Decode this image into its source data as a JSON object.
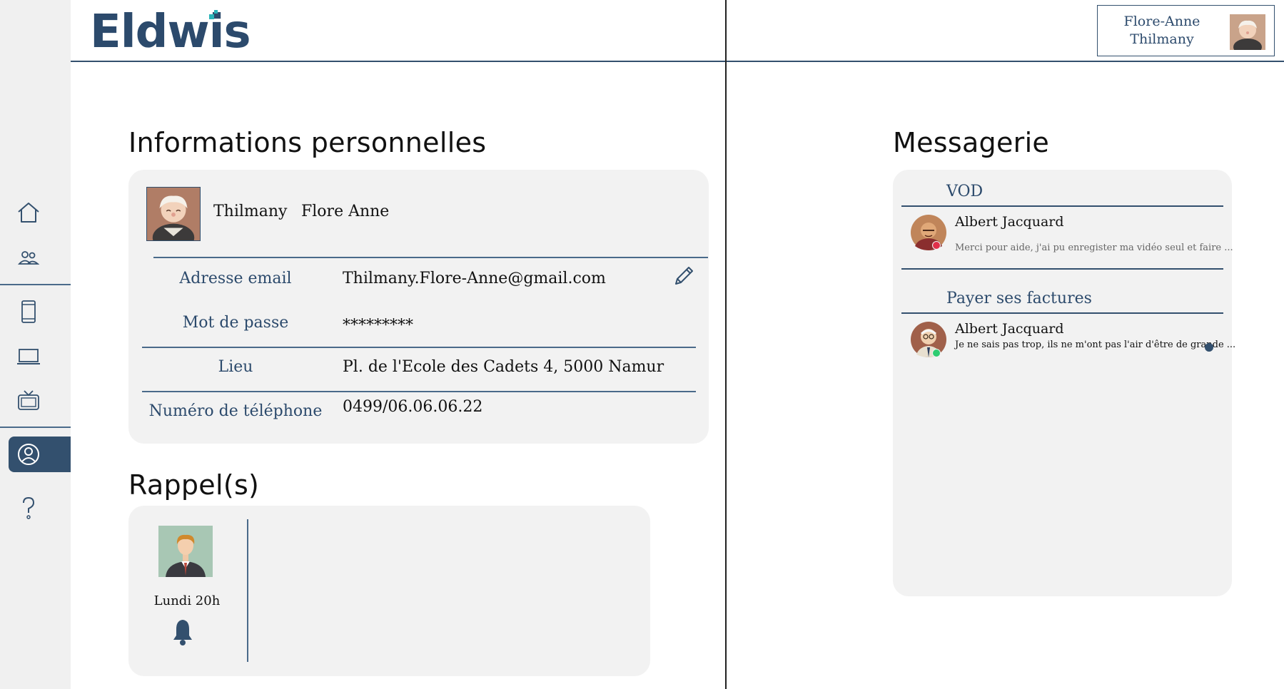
{
  "app": {
    "logo": "Eldwis"
  },
  "user": {
    "first_name": "Flore-Anne",
    "last_name": "Thilmany"
  },
  "colors": {
    "primary": "#33506e",
    "accent": "#2ab3b8",
    "card": "#f2f2f2",
    "online": "#2ecc71",
    "busy": "#e0304a"
  },
  "sidebar": {
    "items": [
      {
        "name": "home",
        "icon": "home-icon"
      },
      {
        "name": "contacts",
        "icon": "users-icon"
      },
      {
        "name": "phone",
        "icon": "phone-icon"
      },
      {
        "name": "computer",
        "icon": "laptop-icon"
      },
      {
        "name": "television",
        "icon": "tv-icon"
      },
      {
        "name": "profile",
        "icon": "user-circle-icon",
        "active": true
      },
      {
        "name": "help",
        "icon": "question-icon"
      }
    ]
  },
  "personal_info": {
    "title": "Informations personnelles",
    "last_name": "Thilmany",
    "first_name": "Flore Anne",
    "fields": [
      {
        "label": "Adresse email",
        "value": "Thilmany.Flore-Anne@gmail.com"
      },
      {
        "label": "Mot de passe",
        "value": "*********"
      },
      {
        "label": "Lieu",
        "value": "Pl. de l'Ecole des Cadets 4, 5000 Namur"
      },
      {
        "label": "Numéro de téléphone",
        "value": "0499/06.06.06.22"
      }
    ]
  },
  "reminders": {
    "title": "Rappel(s)",
    "items": [
      {
        "time": "Lundi 20h",
        "icon": "bell-icon"
      }
    ]
  },
  "messaging": {
    "title": "Messagerie",
    "categories": [
      {
        "name": "VOD",
        "messages": [
          {
            "sender": "Albert Jacquard",
            "preview": "Merci pour aide, j'ai pu enregister ma vidéo seul et faire ...",
            "status": "busy",
            "unread": false
          }
        ]
      },
      {
        "name": "Payer ses factures",
        "messages": [
          {
            "sender": "Albert Jacquard",
            "preview": "Je ne sais pas trop, ils ne m'ont pas l'air d'être de grande ...",
            "status": "online",
            "unread": true
          }
        ]
      }
    ]
  }
}
